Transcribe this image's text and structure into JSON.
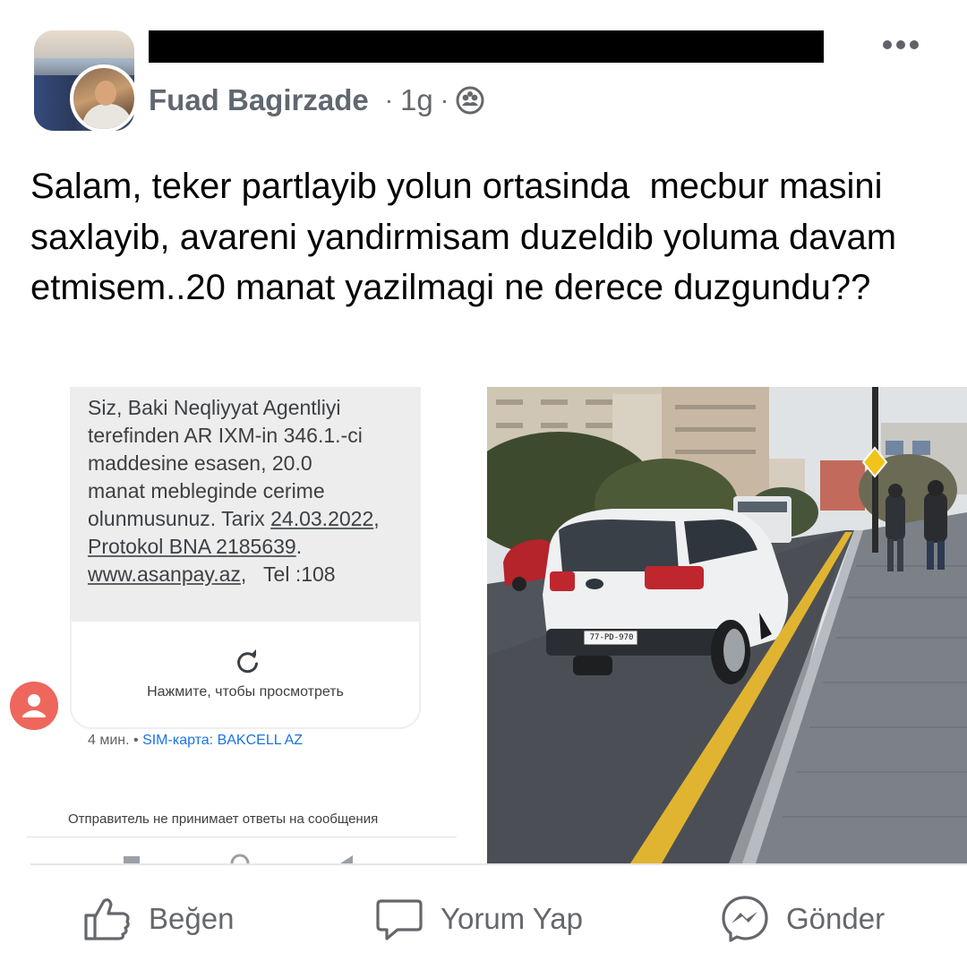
{
  "post": {
    "author": "Fuad Bagirzade",
    "time": "1g",
    "separator": "·",
    "privacy_icon": "group-members-icon",
    "text": "Salam, teker partlayib yolun ortasinda  mecbur masini saxlayib, avareni yandirmisam duzeldib yoluma davam etmisem..20 manat yazilmagi ne derece duzgundu??"
  },
  "sms": {
    "lines": [
      "Siz, Baki Neqliyyat Agentliyi",
      "terefinden AR IXM-in 346.1.-ci",
      "maddesine esasen, 20.0",
      "manat mebleginde cerime",
      "olunmusunuz. Tarix "
    ],
    "date": "24.03.2022",
    "date_suffix": ",",
    "protocol": "Protokol BNA 2185639",
    "protocol_suffix": ".",
    "website": "www.asanpay.az",
    "tel": ",   Tel :108",
    "tap_to_view": "Нажмите, чтобы просмотреть",
    "time": "4 мин.",
    "meta_sep": " • ",
    "sim": "SIM-карта: BAKCELL AZ",
    "no_reply": "Отправитель не принимает ответы на сообщения"
  },
  "photo": {
    "plate": "77-PD-970"
  },
  "actions": {
    "like": "Beğen",
    "comment": "Yorum Yap",
    "send": "Gönder"
  },
  "colors": {
    "action_gray": "#65676b",
    "sms_link": "#1a73e8",
    "contact_avatar": "#ee675c",
    "road_line": "#e0b431"
  }
}
